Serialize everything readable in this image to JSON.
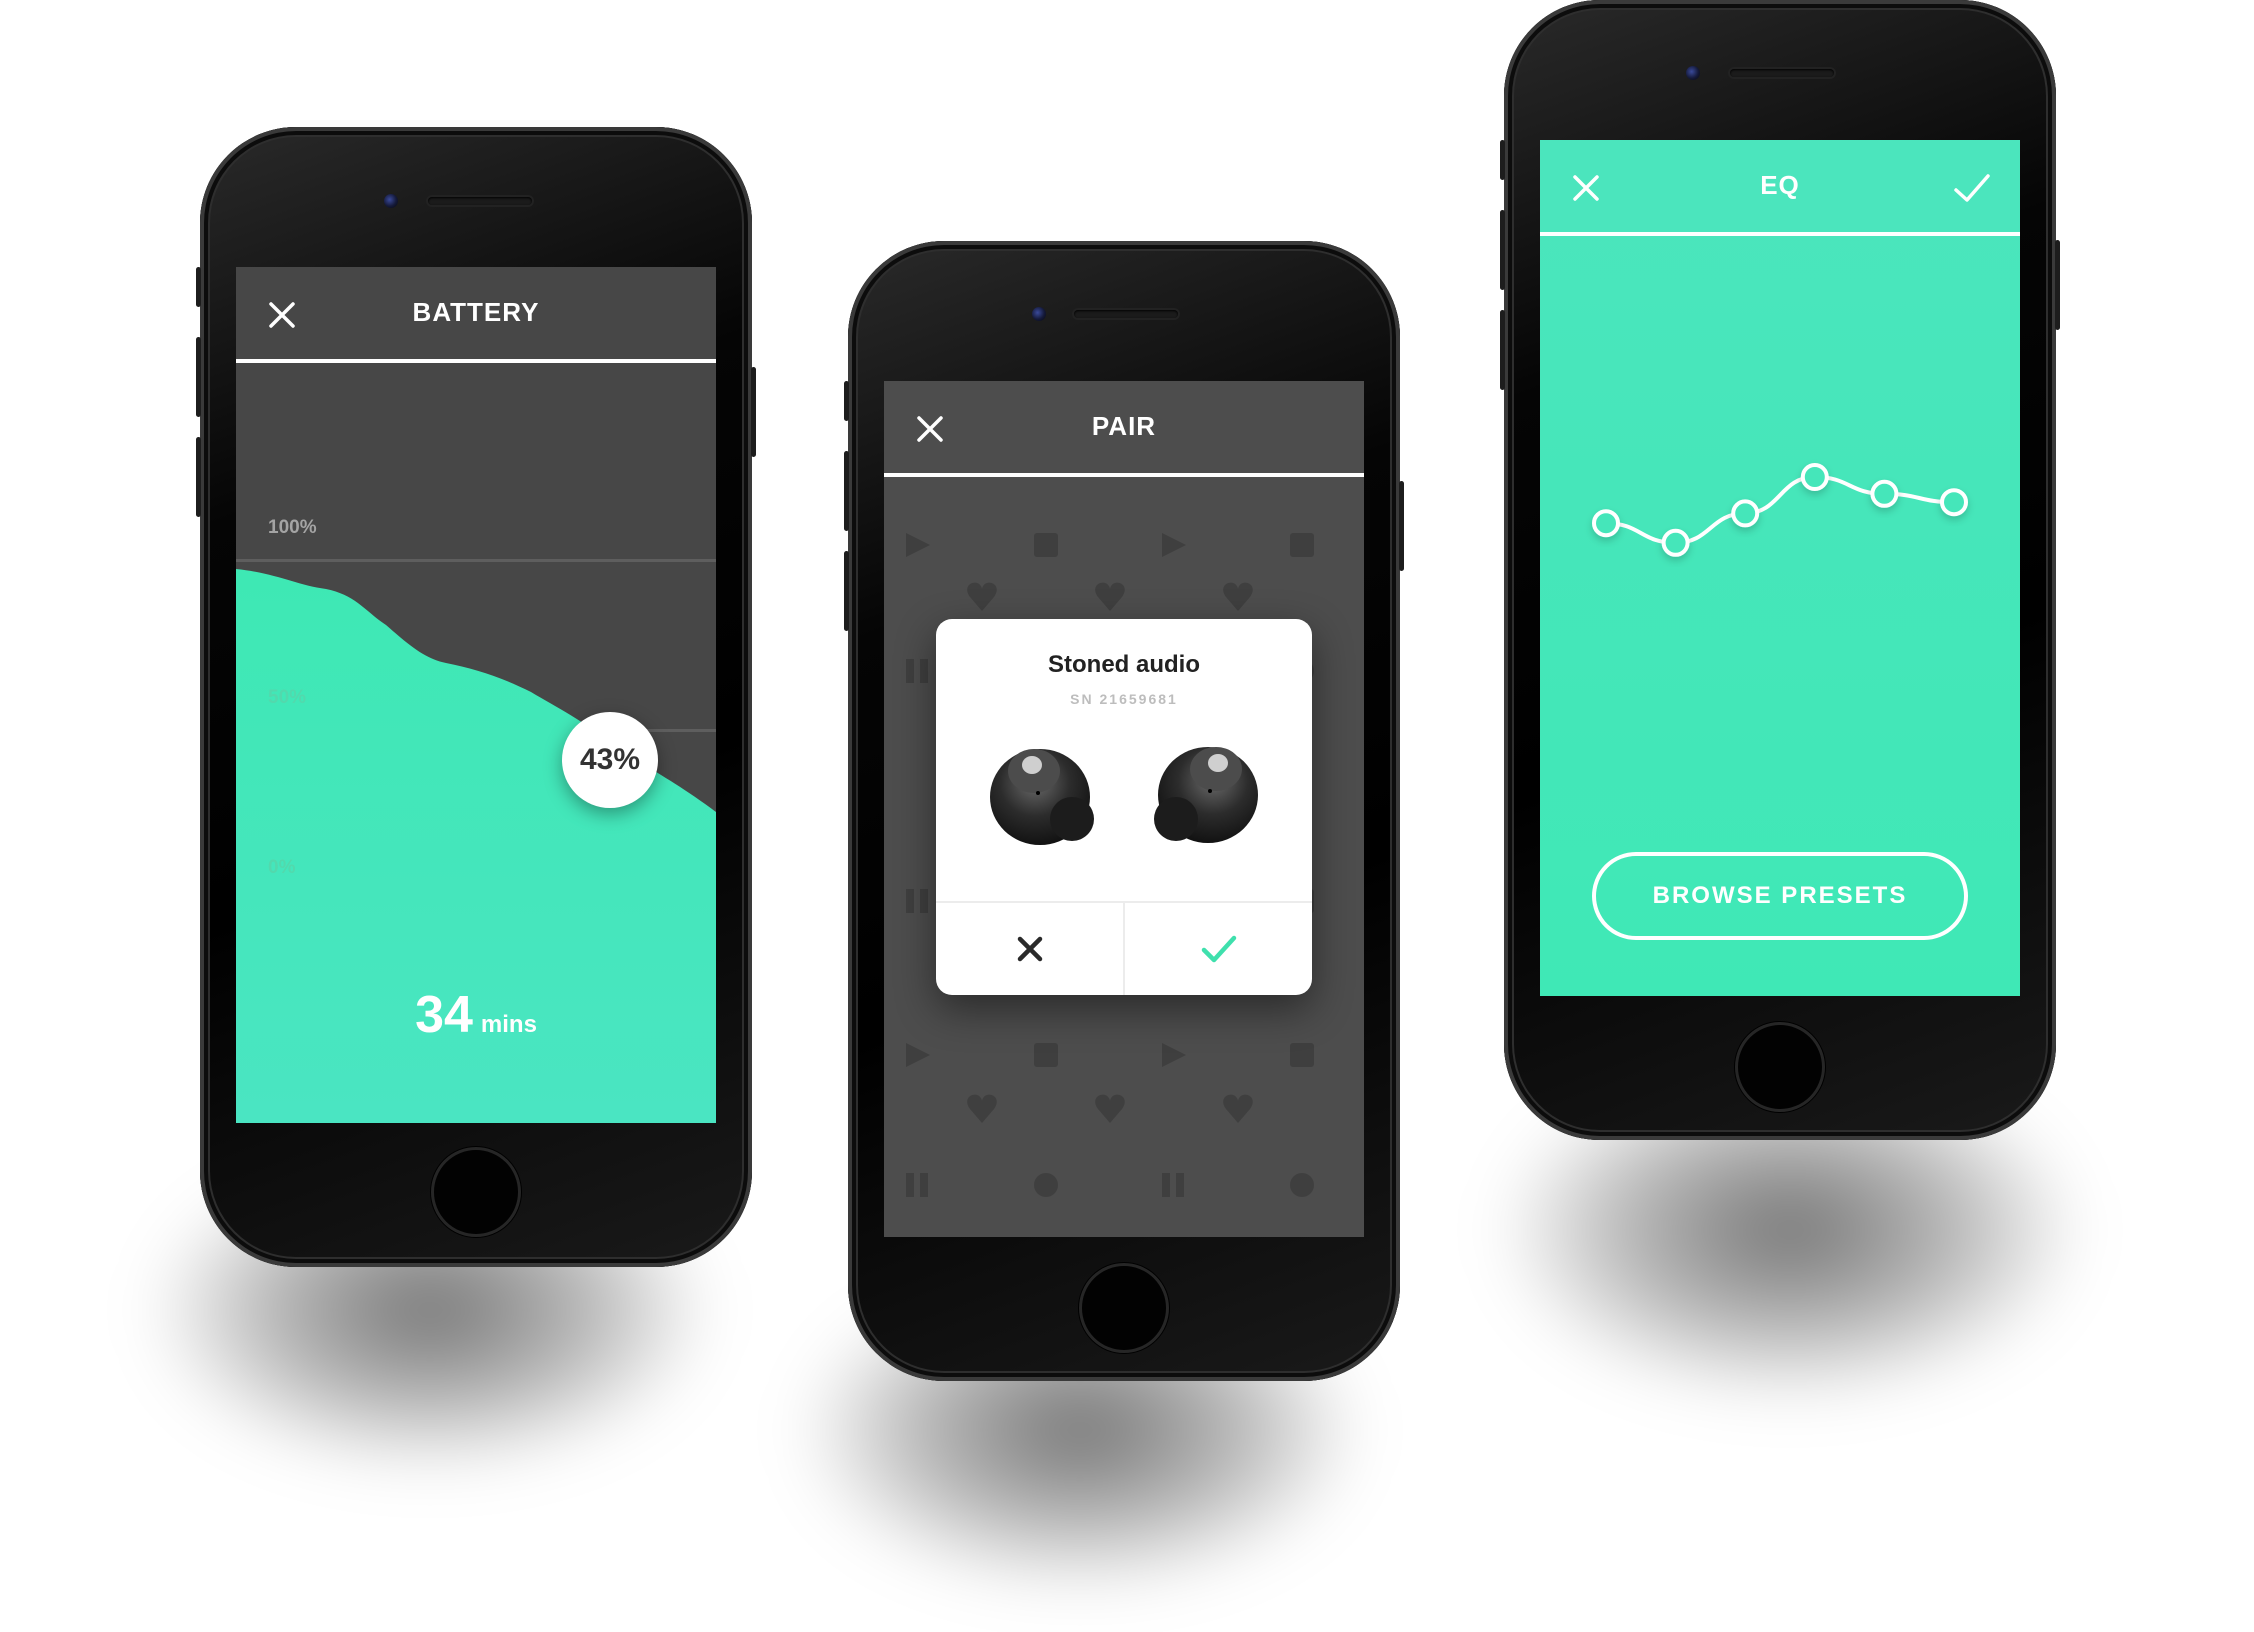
{
  "battery": {
    "title": "BATTERY",
    "grid_labels": [
      "100%",
      "50%",
      "0%"
    ],
    "level": "43%",
    "level_fraction": 0.43,
    "remaining_value": "34",
    "remaining_unit": "mins"
  },
  "pair": {
    "title": "PAIR",
    "device_name": "Stoned audio",
    "serial": "SN 21659681",
    "cancel_icon": "close-icon",
    "confirm_icon": "check-icon"
  },
  "eq": {
    "title": "EQ",
    "presets_label": "BROWSE PRESETS",
    "band_levels": [
      0.62,
      0.48,
      0.69,
      0.95,
      0.83,
      0.77
    ]
  },
  "colors": {
    "accent": "#3fe8b6",
    "dark_screen": "#474747",
    "confirm": "#3fe0ad"
  }
}
